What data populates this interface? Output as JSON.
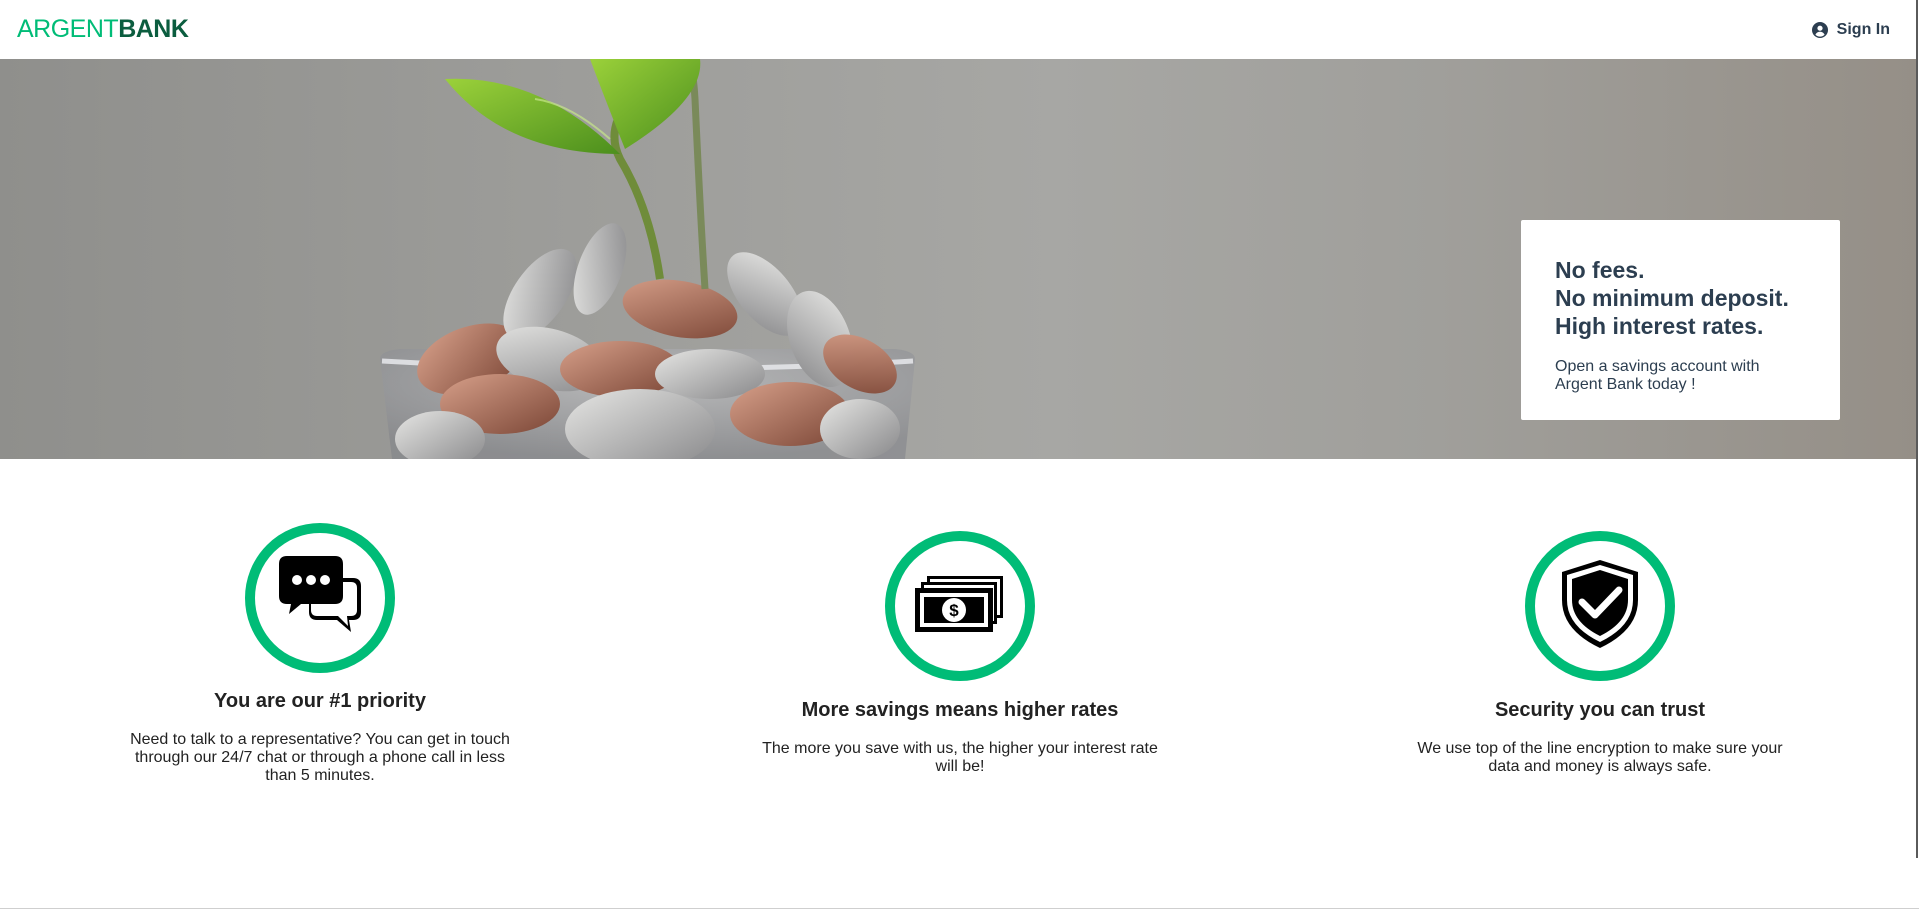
{
  "nav": {
    "logo": {
      "part_a": "ARGENT",
      "part_b": "BANK"
    },
    "sign_in_label": "Sign In",
    "sign_in_icon": "user-circle-icon"
  },
  "hero": {
    "subtitles": [
      "No fees.",
      "No minimum deposit.",
      "High interest rates."
    ],
    "text": "Open a savings account with Argent Bank today !"
  },
  "features": [
    {
      "icon": "chat-icon",
      "title": "You are our #1 priority",
      "text": "Need to talk to a representative? You can get in touch through our 24/7 chat or through a phone call in less than 5 minutes."
    },
    {
      "icon": "money-icon",
      "title": "More savings means higher rates",
      "text": "The more you save with us, the higher your interest rate will be!"
    },
    {
      "icon": "security-icon",
      "title": "Security you can trust",
      "text": "We use top of the line encryption to make sure your data and money is always safe."
    }
  ],
  "colors": {
    "accent": "#00bc77",
    "logo_dark": "#0b5d3f",
    "text_dark": "#2c3e50"
  }
}
